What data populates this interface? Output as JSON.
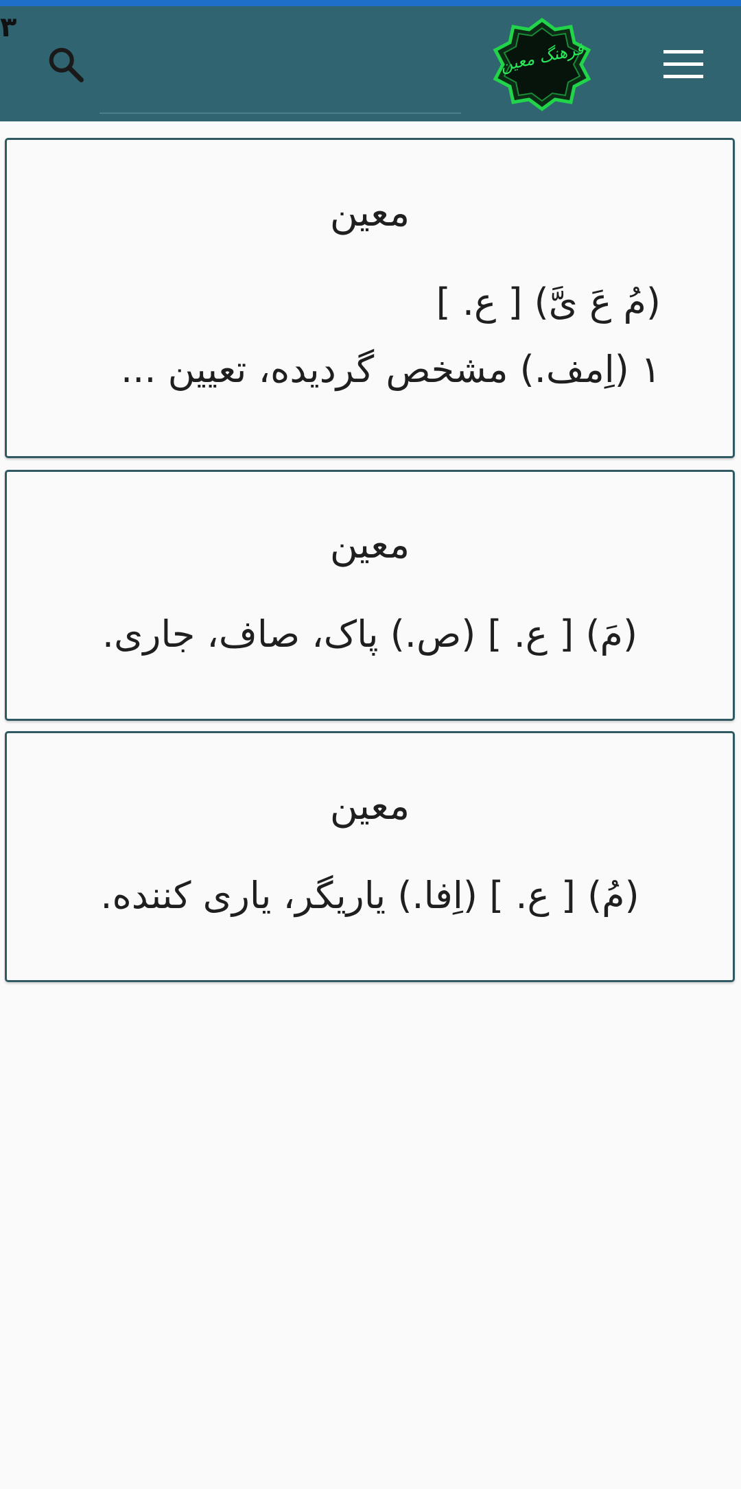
{
  "app": {
    "result_count": "۳",
    "search": {
      "value": "",
      "placeholder": ""
    },
    "logo_text": "فرهنگ معین",
    "colors": {
      "status_strip": "#1e6fc8",
      "appbar": "#2f6470",
      "card_border": "#2f5a63",
      "logo_green": "#22d44a"
    }
  },
  "results": [
    {
      "title": "معین",
      "line1": "(مُ عَ یَّ) [ ع. ]",
      "line2": "۱ (اِمف.) مشخص گردیده، تعیین  ..."
    },
    {
      "title": "معین",
      "line1": "(مَ) [ ع. ] (ص.) پاک، صاف، جاری."
    },
    {
      "title": "معین",
      "line1": "(مُ) [ ع. ] (اِفا.) یاریگر، یاری کننده."
    }
  ]
}
